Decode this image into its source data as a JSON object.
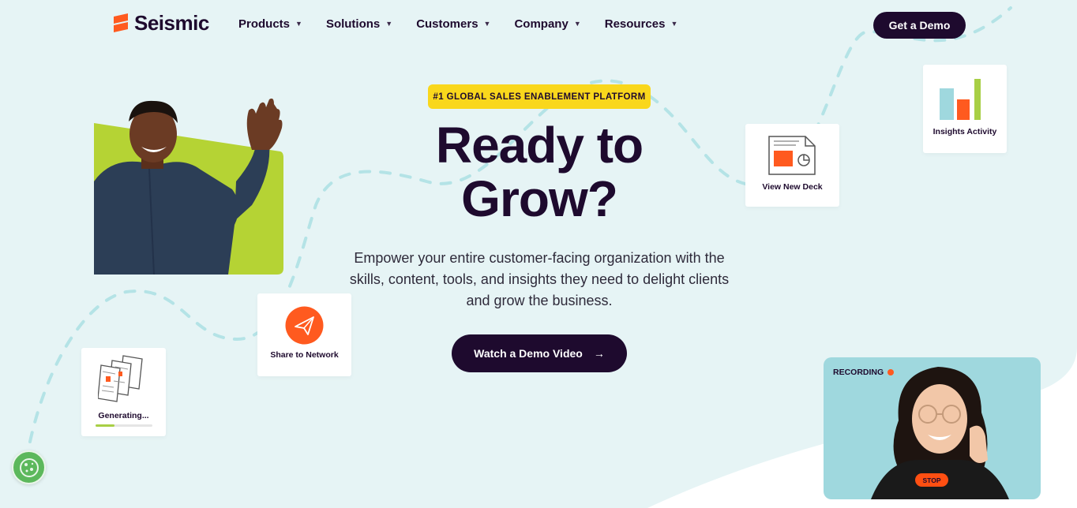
{
  "brand": {
    "name": "Seismic",
    "accent": "#ff5a1f",
    "dark": "#1e0a2e",
    "lime": "#a8cf45",
    "yellow": "#f9d71c"
  },
  "nav": {
    "items": [
      {
        "label": "Products"
      },
      {
        "label": "Solutions"
      },
      {
        "label": "Customers"
      },
      {
        "label": "Company"
      },
      {
        "label": "Resources"
      }
    ],
    "cta": "Get a Demo"
  },
  "hero": {
    "badge": "#1 GLOBAL SALES ENABLEMENT PLATFORM",
    "headline_line1": "Ready to",
    "headline_line2": "Grow?",
    "subtext": "Empower your entire customer-facing organization with the skills, content, tools, and insights they need to delight clients and grow the business.",
    "cta": "Watch a Demo Video",
    "cta_icon": "arrow-right-icon"
  },
  "cards": {
    "share": {
      "label": "Share to Network",
      "icon": "paper-plane-icon"
    },
    "deck": {
      "label": "View New Deck",
      "icon": "presentation-deck-icon"
    },
    "insights": {
      "label": "Insights Activity",
      "icon": "bar-chart-icon"
    },
    "generating": {
      "label": "Generating...",
      "icon": "documents-stack-icon",
      "progress": 0.33
    }
  },
  "recording": {
    "label": "RECORDING",
    "stop": "STOP"
  },
  "cookie": {
    "icon": "cookie-icon"
  }
}
